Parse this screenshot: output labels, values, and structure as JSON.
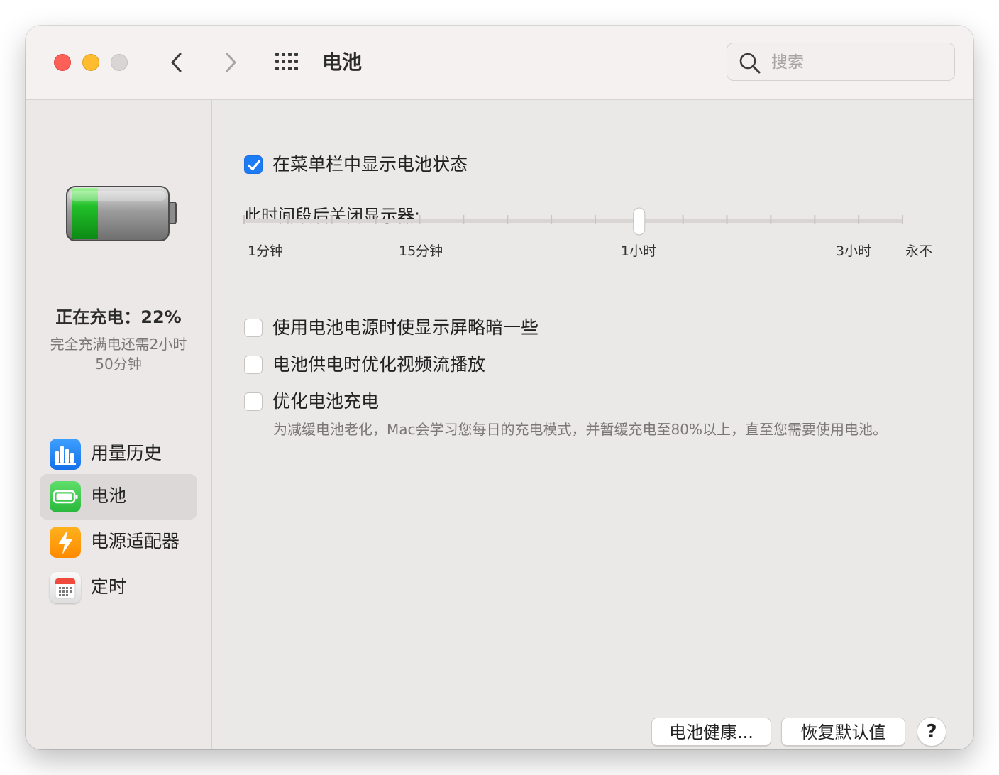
{
  "window": {
    "title": "电池"
  },
  "search": {
    "placeholder": "搜索"
  },
  "sidebar": {
    "status_title": "正在充电：22%",
    "status_detail": "完全充满电还需2小时50分钟",
    "items": [
      {
        "label": "用量历史",
        "icon": "usage-history-icon",
        "selected": false
      },
      {
        "label": "电池",
        "icon": "battery-icon",
        "selected": true
      },
      {
        "label": "电源适配器",
        "icon": "power-adapter-icon",
        "selected": false
      },
      {
        "label": "定时",
        "icon": "schedule-icon",
        "selected": false
      }
    ]
  },
  "main": {
    "show_in_menubar": {
      "label": "在菜单栏中显示电池状态",
      "checked": true
    },
    "display_off_label": "此时间段后关闭显示器:",
    "slider": {
      "labels": [
        "1分钟",
        "15分钟",
        "1小时",
        "3小时",
        "永不"
      ],
      "value": "1小时",
      "position_fraction": 0.6
    },
    "dim_display": {
      "label": "使用电池电源时使显示屏略暗一些",
      "checked": false
    },
    "optimize_video": {
      "label": "电池供电时优化视频流播放",
      "checked": false
    },
    "optimized_charging": {
      "label": "优化电池充电",
      "checked": false,
      "description": "为减缓电池老化，Mac会学习您每日的充电模式，并暂缓充电至80%以上，直至您需要使用电池。"
    }
  },
  "footer": {
    "battery_health_label": "电池健康...",
    "restore_defaults_label": "恢复默认值",
    "help_label": "?"
  },
  "colors": {
    "accent": "#1b7cf5",
    "battery_charge": "#22c02a",
    "close": "#fe5f57",
    "minimize": "#febc2e"
  },
  "battery_level": 0.22
}
